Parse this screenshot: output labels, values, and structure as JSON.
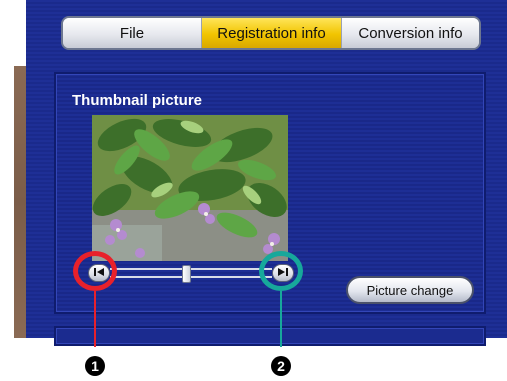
{
  "tabs": [
    {
      "label": "File",
      "active": false
    },
    {
      "label": "Registration info",
      "active": true
    },
    {
      "label": "Conversion info",
      "active": false
    }
  ],
  "panel": {
    "title": "Thumbnail picture",
    "slider_position": 0.47
  },
  "buttons": {
    "picture_change": "Picture change"
  },
  "callouts": [
    {
      "number": "1",
      "color": "#e8212b"
    },
    {
      "number": "2",
      "color": "#17a89b"
    }
  ],
  "icons": {
    "prev_frame": "skip-to-start-icon",
    "next_frame": "skip-to-end-icon"
  },
  "colors": {
    "active_tab": "#f1c400",
    "panel_blue": "#1d2e95"
  }
}
